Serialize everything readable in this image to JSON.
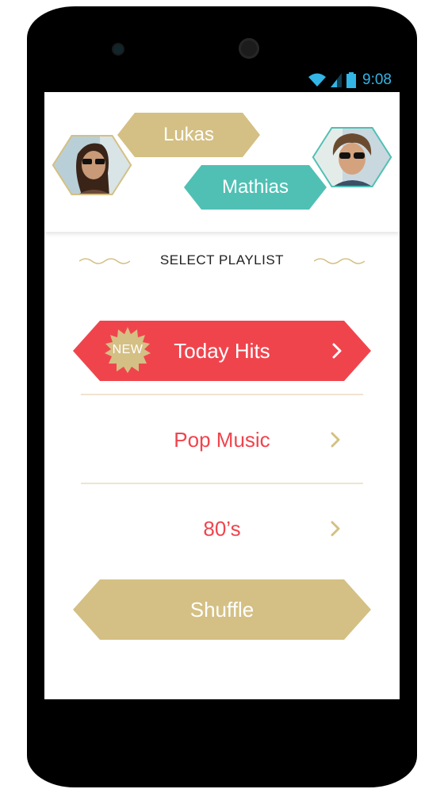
{
  "status_bar": {
    "time": "9:08",
    "icons": [
      "wifi-icon",
      "signal-icon",
      "battery-icon"
    ],
    "accent": "#33b5e5"
  },
  "users": [
    {
      "name": "Lukas",
      "color": "#d4c084"
    },
    {
      "name": "Mathias",
      "color": "#50c0b4"
    }
  ],
  "section": {
    "title": "SELECT PLAYLIST"
  },
  "playlists": [
    {
      "label": "Today Hits",
      "badge": "NEW",
      "highlighted": true
    },
    {
      "label": "Pop Music",
      "highlighted": false
    },
    {
      "label": "80’s",
      "highlighted": false
    }
  ],
  "shuffle": {
    "label": "Shuffle"
  },
  "colors": {
    "red": "#f0444d",
    "gold": "#d4c084",
    "teal": "#50c0b4",
    "divider": "#f0e4cf"
  }
}
